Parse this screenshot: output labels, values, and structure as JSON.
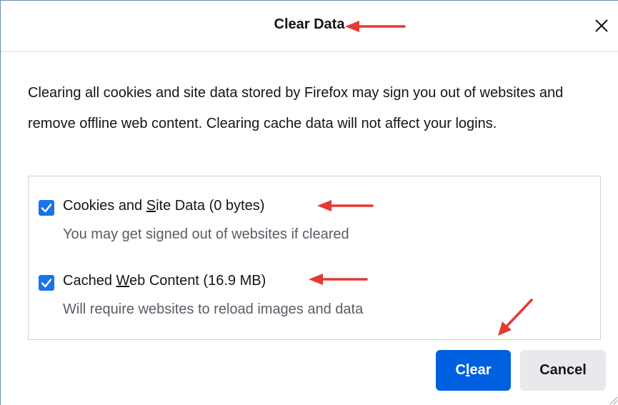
{
  "dialog": {
    "title": "Clear Data",
    "close_icon": "close-icon",
    "description": "Clearing all cookies and site data stored by Firefox may sign you out of websites and remove offline web content. Clearing cache data will not affect your logins."
  },
  "options": [
    {
      "label_pre": "Cookies and ",
      "label_access": "S",
      "label_post": "ite Data (0 bytes)",
      "hint": "You may get signed out of websites if cleared",
      "checked": true
    },
    {
      "label_pre": "Cached ",
      "label_access": "W",
      "label_post": "eb Content (16.9 MB)",
      "hint": "Will require websites to reload images and data",
      "checked": true
    }
  ],
  "buttons": {
    "clear_pre": "C",
    "clear_access": "l",
    "clear_post": "ear",
    "cancel": "Cancel"
  },
  "colors": {
    "accent": "#0061e0",
    "checkbox": "#1a73e8",
    "annotation_arrow": "#e53935"
  }
}
